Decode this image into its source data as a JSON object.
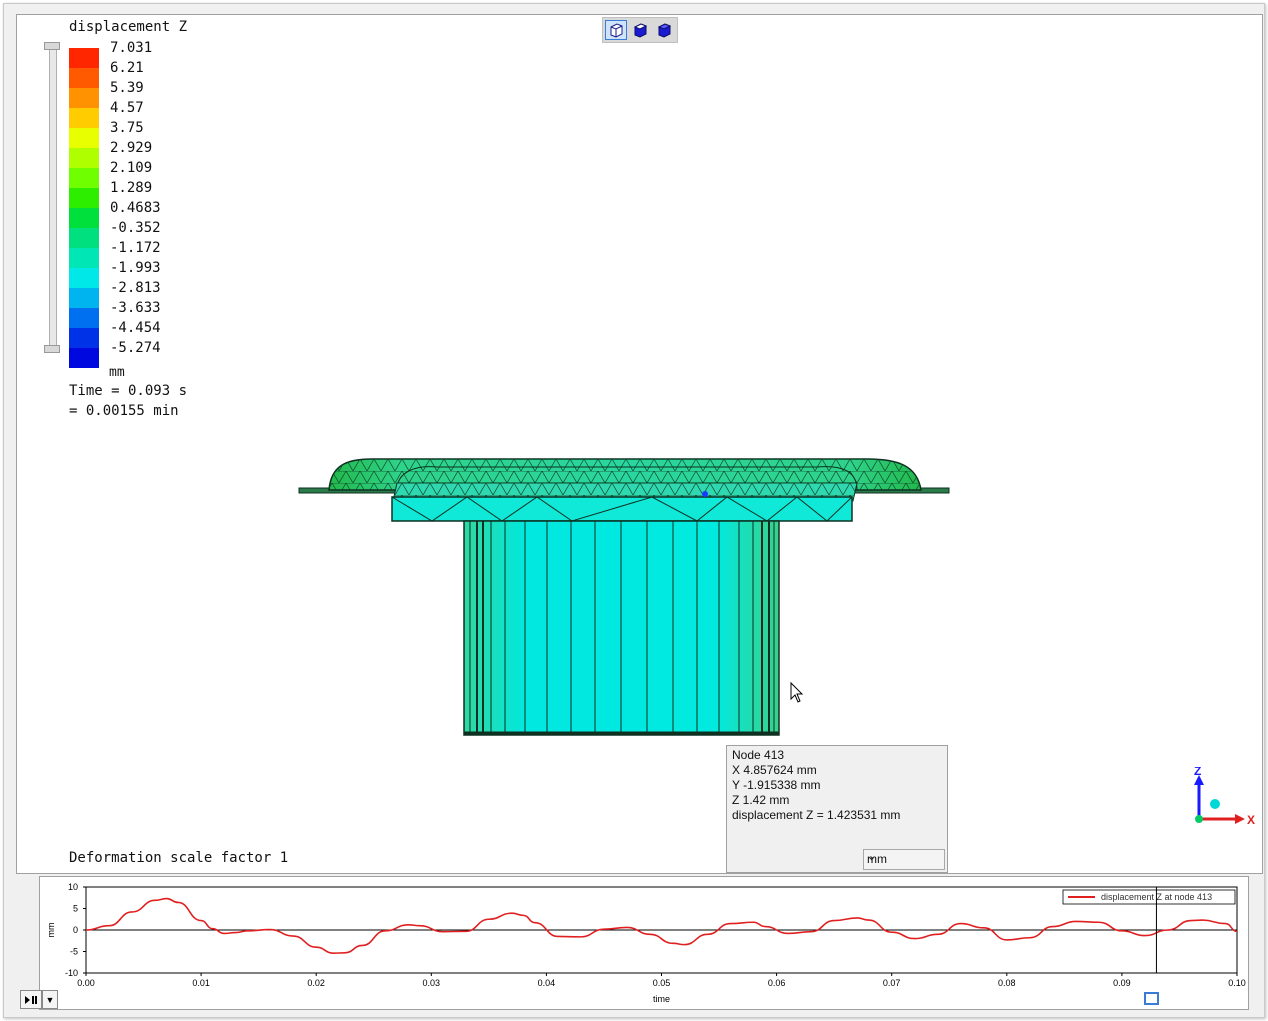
{
  "toolbar": {
    "icons": [
      "wireframe-cube-icon",
      "shaded-cube-icon",
      "solid-cube-icon"
    ]
  },
  "legend": {
    "title": "displacement Z",
    "values": [
      "7.031",
      "6.21",
      "5.39",
      "4.57",
      "3.75",
      "2.929",
      "2.109",
      "1.289",
      "0.4683",
      "-0.352",
      "-1.172",
      "-1.993",
      "-2.813",
      "-3.633",
      "-4.454",
      "-5.274"
    ],
    "colors": [
      "#ff2600",
      "#ff5a00",
      "#ff9200",
      "#ffcc00",
      "#e8ff00",
      "#b0ff00",
      "#70ff00",
      "#2eee00",
      "#00e03c",
      "#00e07e",
      "#00e6b4",
      "#00e8e8",
      "#00b4f0",
      "#0070f0",
      "#0032e8",
      "#0008e0"
    ],
    "unit": "mm"
  },
  "time": {
    "seconds": "Time = 0.093 s",
    "minutes": "= 0.00155 min"
  },
  "deformation": "Deformation scale factor 1",
  "tooltip": {
    "node": "Node  413",
    "x": "X  4.857624 mm",
    "y": "Y  -1.915338 mm",
    "z": "Z  1.42 mm",
    "disp": "displacement Z = 1.423531 mm",
    "unit_select": "mm"
  },
  "axes_triad": {
    "z": "Z",
    "x": "X",
    "colors": {
      "z": "#1a1aff",
      "x": "#e02020",
      "origin": "#00cc66"
    }
  },
  "chart_data": {
    "type": "line",
    "title": "",
    "xlabel": "time",
    "ylabel": "mm",
    "xlim": [
      0.0,
      0.1
    ],
    "ylim": [
      -10,
      10
    ],
    "xticks": [
      "0.00",
      "0.01",
      "0.02",
      "0.03",
      "0.04",
      "0.05",
      "0.06",
      "0.07",
      "0.08",
      "0.09",
      "0.10"
    ],
    "yticks": [
      "10",
      "5",
      "0",
      "-5",
      "-10"
    ],
    "legend_position": "top-right",
    "current_time": 0.093,
    "series": [
      {
        "name": "displacement Z at node 413",
        "color": "#e02020",
        "x": [
          0.0,
          0.002,
          0.004,
          0.006,
          0.007,
          0.008,
          0.01,
          0.011,
          0.012,
          0.013,
          0.014,
          0.016,
          0.018,
          0.02,
          0.0215,
          0.0225,
          0.024,
          0.026,
          0.028,
          0.029,
          0.031,
          0.033,
          0.035,
          0.037,
          0.038,
          0.039,
          0.041,
          0.043,
          0.045,
          0.047,
          0.049,
          0.051,
          0.052,
          0.054,
          0.056,
          0.058,
          0.059,
          0.061,
          0.063,
          0.065,
          0.067,
          0.068,
          0.07,
          0.072,
          0.074,
          0.076,
          0.078,
          0.08,
          0.082,
          0.084,
          0.086,
          0.088,
          0.09,
          0.092,
          0.094,
          0.096,
          0.097,
          0.099,
          0.1
        ],
        "y": [
          0,
          1.0,
          4.2,
          6.9,
          7.3,
          6.4,
          2.2,
          0.3,
          -0.8,
          -0.6,
          -0.2,
          0.1,
          -1.4,
          -4.0,
          -5.4,
          -5.3,
          -3.6,
          -0.2,
          1.2,
          1.0,
          -0.4,
          -0.3,
          2.5,
          3.9,
          3.4,
          1.7,
          -1.5,
          -1.6,
          0.2,
          0.6,
          -1.0,
          -3.1,
          -3.4,
          -1.0,
          1.5,
          1.8,
          0.8,
          -0.8,
          -0.4,
          2.2,
          2.8,
          2.3,
          -0.5,
          -2.0,
          -1.0,
          1.5,
          0.5,
          -2.3,
          -1.8,
          0.8,
          2.0,
          1.8,
          -0.2,
          -1.3,
          0.0,
          2.2,
          2.3,
          1.5,
          -0.3
        ]
      }
    ]
  }
}
